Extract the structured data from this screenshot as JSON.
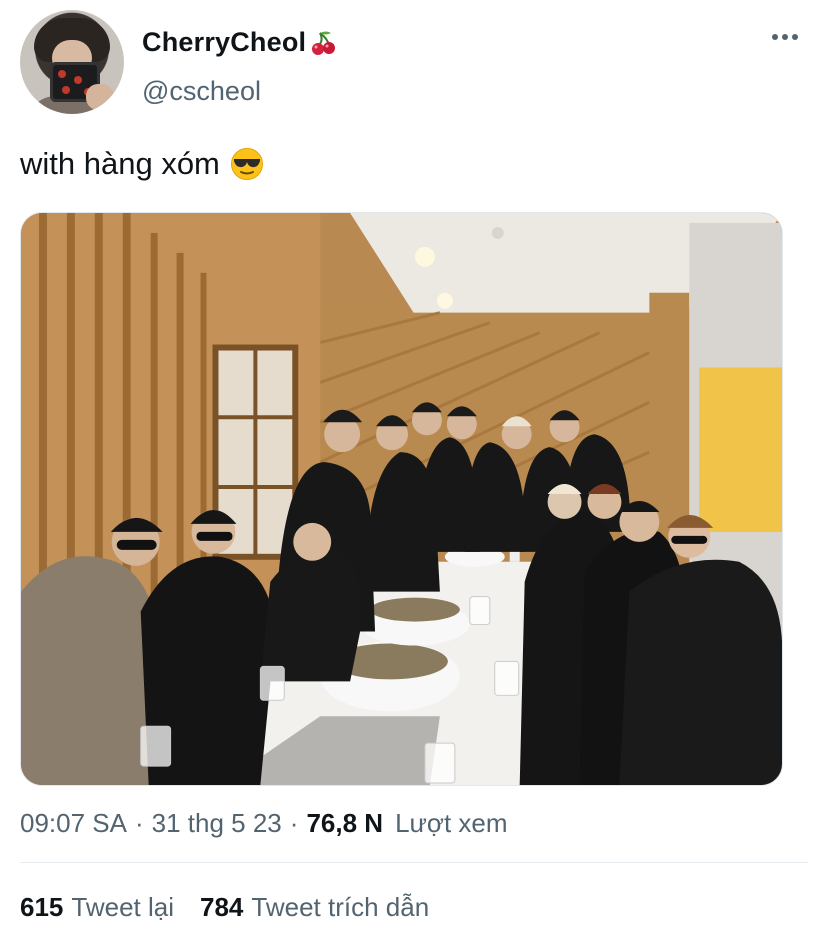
{
  "author": {
    "display_name": "CherryCheol",
    "handle": "@cscheol",
    "name_emoji": "cherry-emoji",
    "avatar": "avatar-photo"
  },
  "menu_icon": "more-options-icon",
  "tweet": {
    "text": "with hàng xóm",
    "emoji": "sunglasses-emoji"
  },
  "media": {
    "type": "photo",
    "description_icon": "group-photo"
  },
  "meta": {
    "time": "09:07 SA",
    "date": "31 thg 5 23",
    "views_count": "76,8 N",
    "views_label": "Lượt xem",
    "separator": "·"
  },
  "stats": {
    "retweets_count": "615",
    "retweets_label": "Tweet lại",
    "quotes_count": "784",
    "quotes_label": "Tweet trích dẫn"
  },
  "colors": {
    "text": "#0f1419",
    "secondary": "#536471",
    "divider": "#e6ecf0"
  }
}
